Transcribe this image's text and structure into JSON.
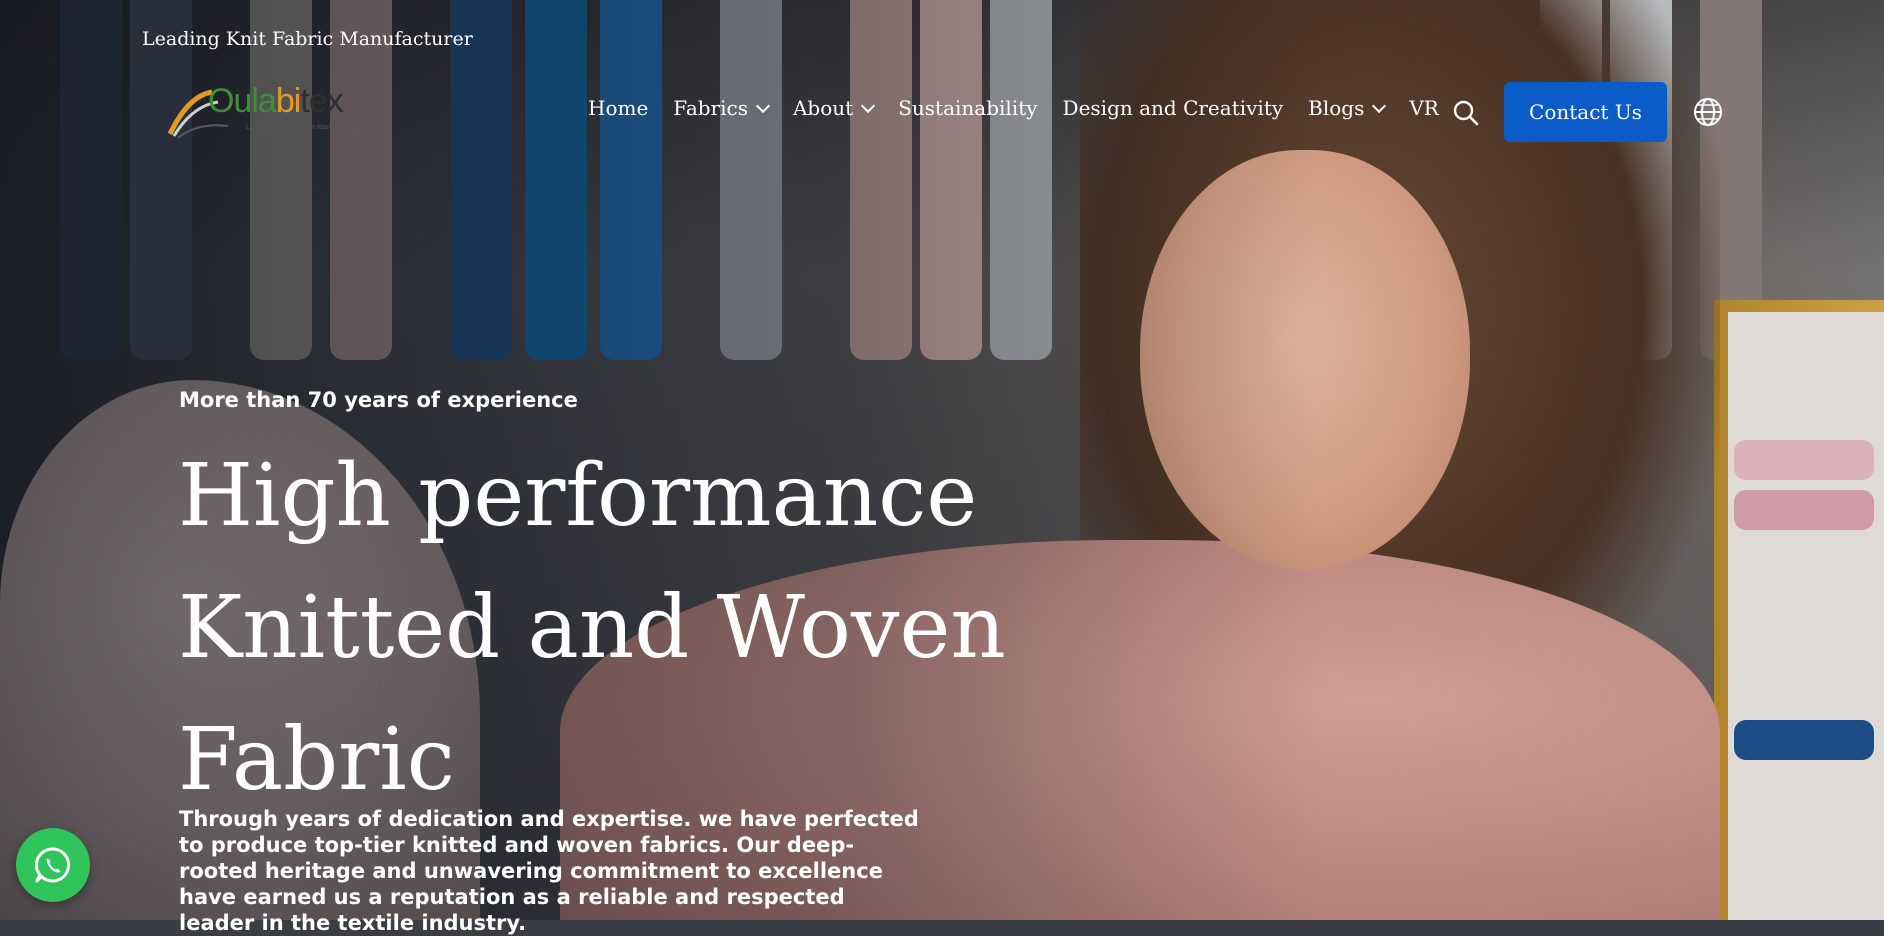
{
  "header": {
    "tagline": "Leading Knit Fabric Manufacturer",
    "logo": {
      "parts": [
        "Oula",
        "bi",
        "tex"
      ],
      "subtitle": "Leading Knit & Woven Manufacturer"
    },
    "nav": [
      {
        "label": "Home",
        "has_dropdown": false
      },
      {
        "label": "Fabrics",
        "has_dropdown": true
      },
      {
        "label": "About",
        "has_dropdown": true
      },
      {
        "label": "Sustainability",
        "has_dropdown": false
      },
      {
        "label": "Design and Creativity",
        "has_dropdown": false
      },
      {
        "label": "Blogs",
        "has_dropdown": true
      },
      {
        "label": "VR",
        "has_dropdown": false
      }
    ],
    "search_icon": "search-icon",
    "contact_button": "Contact Us",
    "language_icon": "globe-icon"
  },
  "hero": {
    "eyebrow": "More than 70 years of experience",
    "headline": [
      "High performance",
      "Knitted and Woven",
      "Fabric"
    ],
    "body": "Through years of dedication and expertise. we have perfected to produce top-tier knitted and woven fabrics. Our deep-rooted heritage and unwavering commitment to excellence have earned us a reputation as a reliable and respected leader in the textile industry."
  },
  "floating": {
    "whatsapp_icon": "whatsapp-icon"
  },
  "colors": {
    "primary_button": "#0b5bc9",
    "whatsapp": "#2fc55a",
    "text": "#ffffff"
  }
}
